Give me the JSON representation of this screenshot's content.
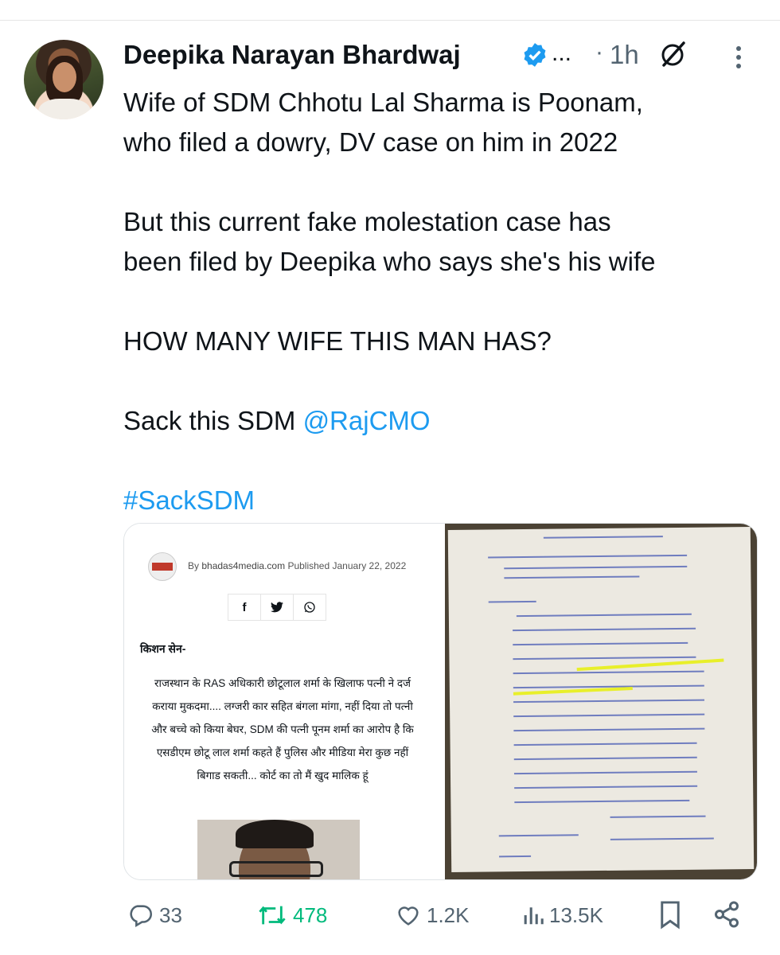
{
  "author": {
    "display_name": "Deepika Narayan Bhardwaj",
    "overflow": "...",
    "separator": "·",
    "timestamp": "1h"
  },
  "tweet": {
    "line1": "Wife of SDM Chhotu Lal Sharma is Poonam,",
    "line2": "who filed a dowry, DV case on him in 2022",
    "line3": "But this current fake molestation case has",
    "line4": "been filed by Deepika who says she's his wife",
    "line5": "HOW MANY WIFE THIS MAN HAS?",
    "line6_prefix": "Sack this SDM ",
    "mention": "@RajCMO",
    "hashtag": "#SackSDM"
  },
  "media": {
    "article": {
      "by": "By",
      "site": "bhadas4media.com",
      "published_label": "Published",
      "date": "January 22, 2022",
      "share_icons": [
        "facebook-icon",
        "twitter-icon",
        "whatsapp-icon"
      ],
      "author": "किशन सेन-",
      "body": "राजस्थान के RAS अधिकारी छोटूलाल शर्मा के खिलाफ पत्नी ने दर्ज कराया मुकदमा.... लग्जरी कार सहित बंगला मांगा, नहीं दिया तो पत्नी और बच्चे को किया बेघर, SDM की पत्नी पूनम शर्मा का आरोप है कि एसडीएम छोटू लाल शर्मा कहते हैं पुलिस और मीडिया मेरा कुछ नहीं बिगाड सकती... कोर्ट का तो मैं खुद मालिक हूं"
    },
    "handwritten_letter": {
      "description_icon": "handwritten-document-image",
      "highlight_color": "#e8ef2a"
    }
  },
  "actions": {
    "replies": "33",
    "reposts": "478",
    "likes": "1.2K",
    "views": "13.5K"
  },
  "colors": {
    "link": "#1d9bf0",
    "verified": "#1d9bf0",
    "repost": "#00ba7c",
    "muted": "#536471"
  }
}
